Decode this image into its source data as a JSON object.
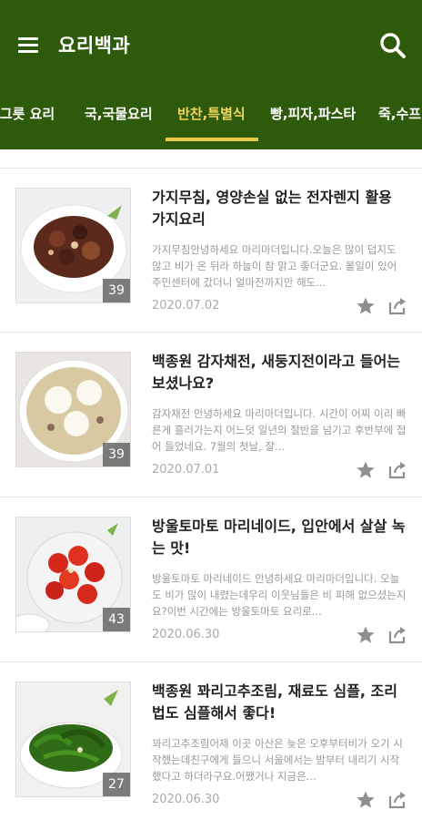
{
  "app_bar": {
    "title": "요리백과",
    "menu_icon": "hamburger-menu-icon",
    "search_icon": "search-icon",
    "background_color": "#2d5a0b"
  },
  "tabs": [
    {
      "label": "한그릇 요리",
      "active": false
    },
    {
      "label": "국,국물요리",
      "active": false
    },
    {
      "label": "반찬,특별식",
      "active": true
    },
    {
      "label": "빵,피자,파스타",
      "active": false
    },
    {
      "label": "죽,수프",
      "active": false
    }
  ],
  "active_tab_color": "#f2d35d",
  "recipes": [
    {
      "title": "가지무침, 영양손실 없는 전자렌지 활용 가지요리",
      "description": "가지무침안녕하세요 마리마더입니다.오늘은 많이 덥지도 않고 비가 온 뒤라 하늘이 참 맑고 좋더군요. 볼일이 있어 주민센터에 갔더니 얼마전까지만 해도...",
      "count": "39",
      "date": "2020.07.02"
    },
    {
      "title": "백종원 감자채전, 새둥지전이라고 들어는 보셨나요?",
      "description": "감자채전 안녕하세요 마리마더입니다. 시간이 어찌 이리 빠른게 흘러가는지 어느덧 일년의 절반을 넘기고 후반부에 접어 들었네요. 7월의 첫날, 잘...",
      "count": "39",
      "date": "2020.07.01"
    },
    {
      "title": "방울토마토 마리네이드, 입안에서 살살 녹는 맛!",
      "description": "방울토마토 마리네이드 안녕하세요 마리마더입니다. 오늘도 비가 많이 내렸는데우리 이웃님들은 비 피해 없으셨는지요?이번 시간에는 방울토마토 요리로...",
      "count": "43",
      "date": "2020.06.30"
    },
    {
      "title": "백종원 꽈리고추조림, 재료도 심플, 조리법도 심플해서 좋다!",
      "description": "꽈리고추조림어제 이곳 아산은 늦은 오후부터비가 오기 시작했는데친구에게 들으니 서울에서는 밤부터 내리기 시작했다고 하더라구요.어쨌거나 지금은...",
      "count": "27",
      "date": "2020.06.30"
    }
  ],
  "action_icons": [
    "star-icon",
    "share-icon"
  ]
}
